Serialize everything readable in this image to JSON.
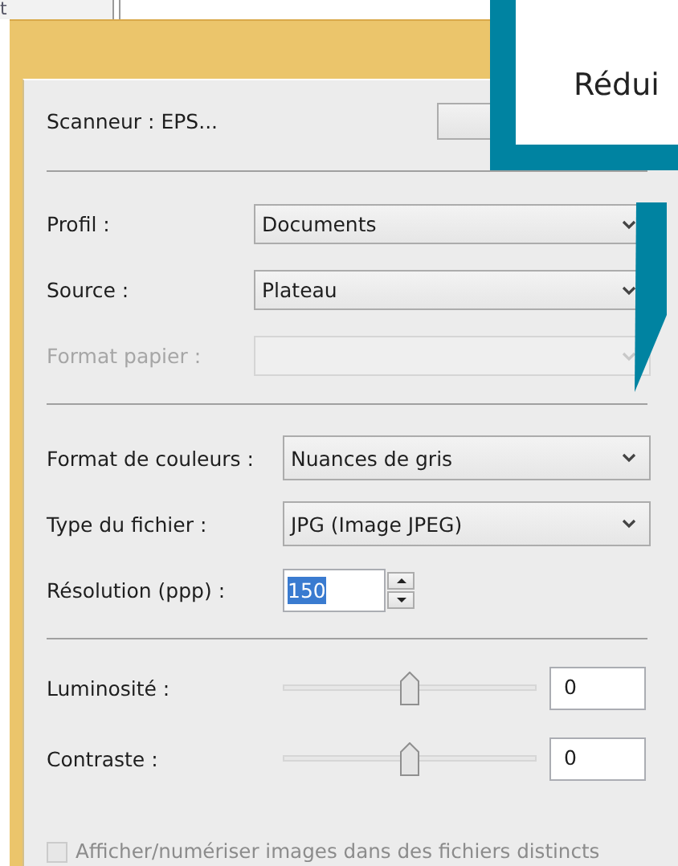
{
  "background_window": {
    "text": "t"
  },
  "dialog": {
    "scanner": {
      "label": "Scanneur : EPS..."
    },
    "sections": [
      {
        "rows": [
          {
            "kind": "combo",
            "label": "Profil :",
            "value": "Documents",
            "disabled": false
          },
          {
            "kind": "combo",
            "label": "Source :",
            "value": "Plateau",
            "disabled": false
          },
          {
            "kind": "combo",
            "label": "Format papier :",
            "disabled": true
          }
        ]
      },
      {
        "rows": [
          {
            "kind": "combo",
            "label": "Format de couleurs :",
            "value": "Nuances de gris",
            "disabled": false
          },
          {
            "kind": "combo",
            "label": "Type du fichier :",
            "value": "JPG (Image JPEG)",
            "disabled": false
          },
          {
            "kind": "spinner",
            "label": "Résolution (ppp) :",
            "value": "150",
            "selected": true
          }
        ]
      },
      {
        "rows": [
          {
            "kind": "slider",
            "label": "Luminosité :",
            "level": 0.5,
            "value": "0"
          },
          {
            "kind": "slider",
            "label": "Contraste :",
            "level": 0.5,
            "value": "0"
          }
        ]
      }
    ],
    "checkbox": {
      "label": "Afficher/numériser images dans des fichiers distincts",
      "checked": false,
      "disabled": true
    }
  },
  "callout": {
    "text": "Rédui"
  }
}
